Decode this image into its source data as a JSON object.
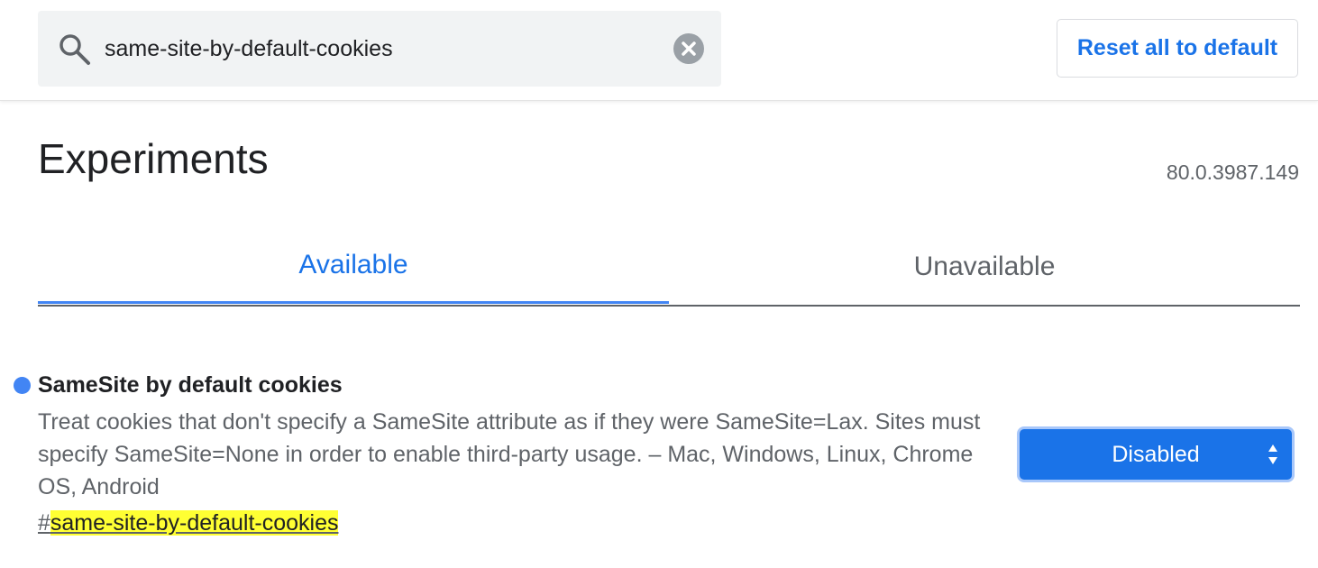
{
  "search": {
    "value": "same-site-by-default-cookies",
    "icon": "search-icon",
    "clear_icon": "close-icon"
  },
  "toolbar": {
    "reset_label": "Reset all to default"
  },
  "page": {
    "title": "Experiments",
    "version": "80.0.3987.149"
  },
  "tabs": [
    {
      "label": "Available",
      "active": true
    },
    {
      "label": "Unavailable",
      "active": false
    }
  ],
  "experiments": [
    {
      "name": "SameSite by default cookies",
      "description": "Treat cookies that don't specify a SameSite attribute as if they were SameSite=Lax. Sites must specify SameSite=None in order to enable third-party usage. – Mac, Windows, Linux, Chrome OS, Android",
      "link_prefix": "#",
      "link_id": "same-site-by-default-cookies",
      "selected_option": "Disabled",
      "status_color": "#4285f4"
    }
  ],
  "colors": {
    "accent": "#1a73e8",
    "highlight": "#ffff33"
  }
}
